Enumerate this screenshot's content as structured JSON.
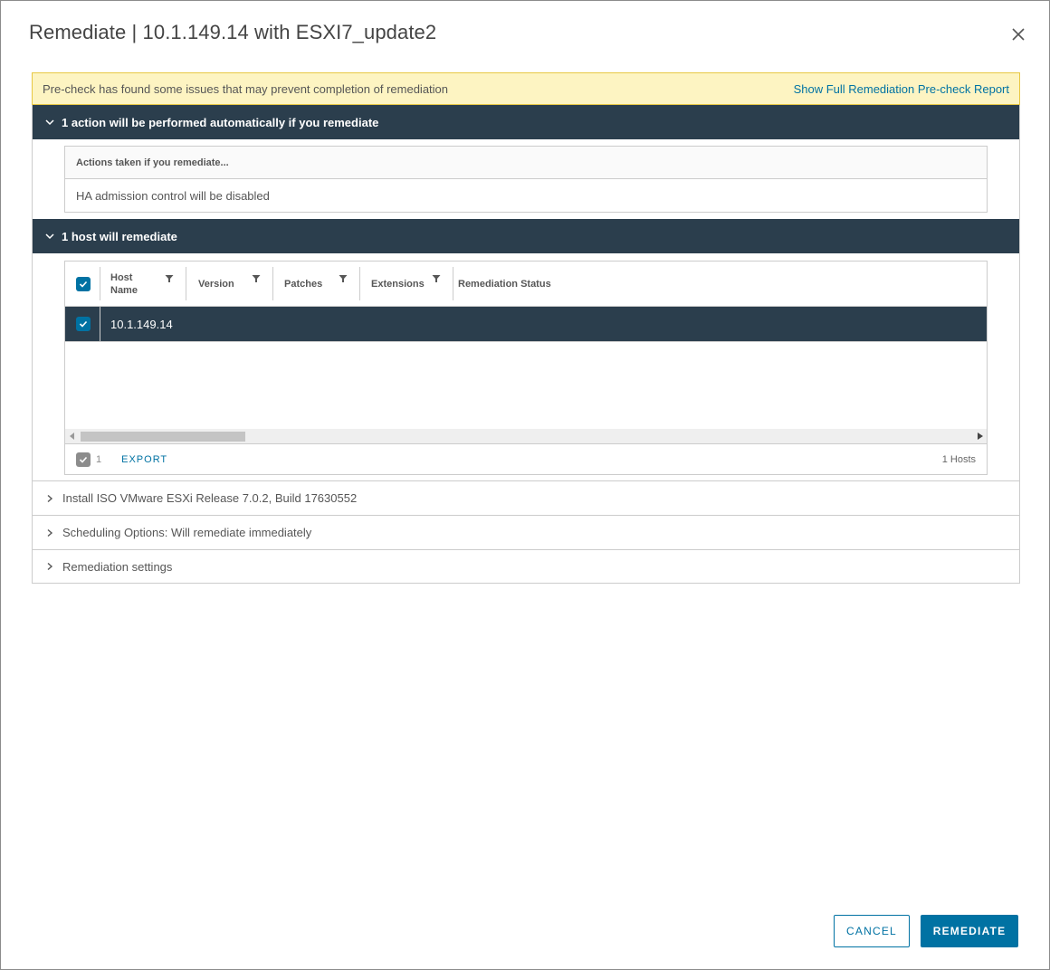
{
  "dialog": {
    "title": "Remediate | 10.1.149.14 with ESXI7_update2"
  },
  "alert": {
    "message": "Pre-check has found some issues that may prevent completion of remediation",
    "link": "Show Full Remediation Pre-check Report"
  },
  "actions_section": {
    "header": "1 action will be performed automatically if you remediate",
    "table_header": "Actions taken if you remediate...",
    "items": [
      "HA admission control will be disabled"
    ]
  },
  "hosts_section": {
    "header": "1 host will remediate",
    "columns": {
      "host_name_line1": "Host",
      "host_name_line2": "Name",
      "version": "Version",
      "patches": "Patches",
      "extensions": "Extensions",
      "remediation_status": "Remediation Status"
    },
    "rows": [
      {
        "host_name": "10.1.149.14",
        "version": "",
        "patches": "",
        "extensions": "",
        "remediation_status": "",
        "selected": true
      }
    ],
    "footer": {
      "selected_count": "1",
      "export_label": "EXPORT",
      "total": "1 Hosts"
    }
  },
  "collapsed_sections": [
    {
      "label": "Install ISO VMware ESXi Release 7.0.2, Build 17630552"
    },
    {
      "label": "Scheduling Options: Will remediate immediately"
    },
    {
      "label": "Remediation settings"
    }
  ],
  "buttons": {
    "cancel": "CANCEL",
    "remediate": "REMEDIATE"
  },
  "colors": {
    "accent": "#0072a3",
    "section_header": "#2b3e4d",
    "alert_bg": "#fdf4c2",
    "alert_border": "#e8c844"
  },
  "icons": {
    "close": "close-icon",
    "expand": "chevron-down-icon",
    "collapsed": "chevron-right-icon",
    "filter": "filter-icon",
    "check": "checkmark-icon"
  }
}
